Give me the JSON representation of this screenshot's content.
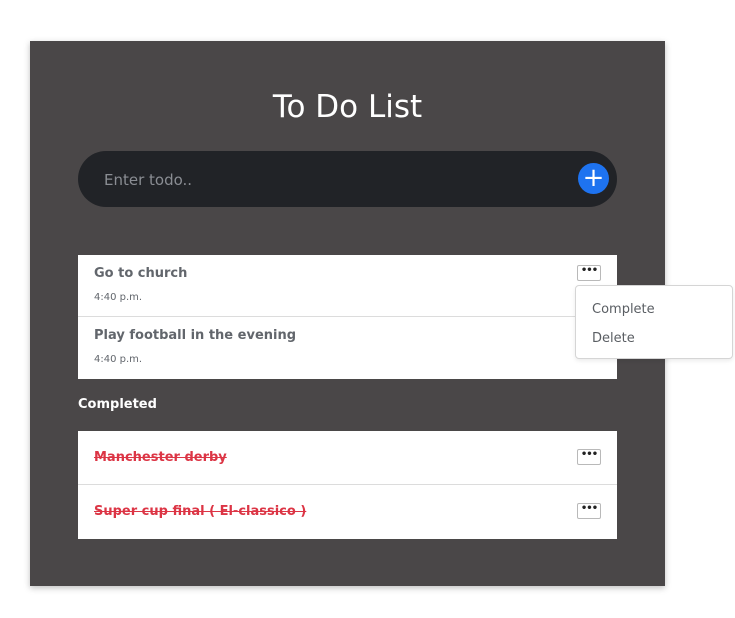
{
  "app": {
    "title": "To Do List"
  },
  "input": {
    "placeholder": "Enter todo..",
    "add_icon": "plus-icon",
    "accent_color": "#1e73f0"
  },
  "todos": [
    {
      "title": "Go to church",
      "time": "4:40 p.m."
    },
    {
      "title": "Play football in the evening",
      "time": "4:40 p.m."
    }
  ],
  "completed_section": {
    "label": "Completed",
    "items": [
      {
        "title": "Manchester derby"
      },
      {
        "title": "Super cup final ( El-classico )"
      }
    ],
    "strike_color": "#dc3545"
  },
  "menu": {
    "button_icon": "ellipsis-icon",
    "button_label": "•••",
    "options": [
      "Complete",
      "Delete"
    ]
  }
}
